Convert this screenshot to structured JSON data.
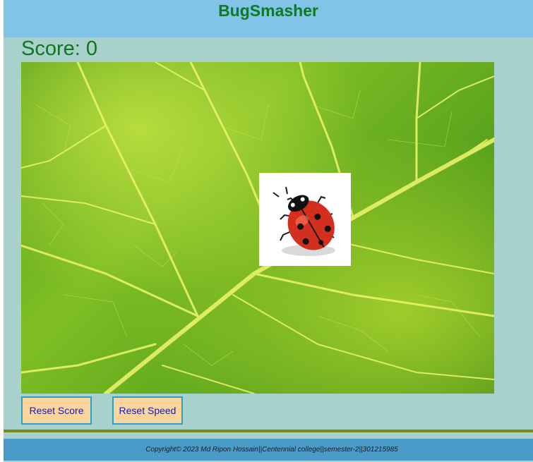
{
  "header": {
    "title": "BugSmasher"
  },
  "game": {
    "score_label": "Score: 0",
    "score": 0,
    "background": "leaf",
    "bug": {
      "kind": "ladybug-icon"
    }
  },
  "buttons": {
    "reset_score": "Reset Score",
    "reset_speed": "Reset Speed"
  },
  "footer": {
    "text": "Copyright© 2023   Md Ripon Hossain||Centennial college||semester-2||301215985"
  },
  "colors": {
    "header_bg": "#82c4e8",
    "page_bg": "#a8d1cc",
    "title": "#0f7a1e",
    "button_bg": "#fbd59c",
    "button_border": "#2aa0c8",
    "footer_bg": "#4b9bc8",
    "divider": "#7b8a1a"
  }
}
